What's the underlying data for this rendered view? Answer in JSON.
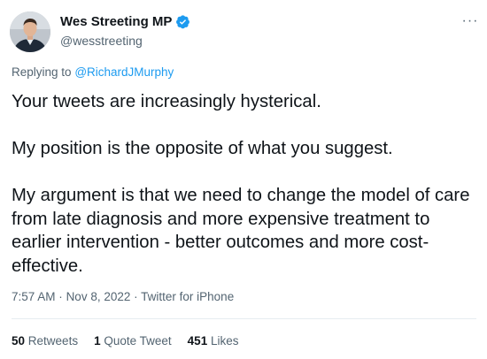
{
  "author": {
    "display_name": "Wes Streeting MP",
    "handle": "@wesstreeting",
    "verified": true,
    "verified_color": "#1d9bf0",
    "avatar_icon": "user-avatar-photo"
  },
  "reply": {
    "prefix": "Replying to",
    "mention": "@RichardJMurphy"
  },
  "tweet": {
    "paragraphs": [
      "Your tweets are increasingly hysterical.",
      "My position is the opposite of what you suggest.",
      "My argument is that we need to change the model of care from late diagnosis and more expensive treatment to earlier intervention - better outcomes and more cost-effective."
    ]
  },
  "meta": {
    "time": "7:57 AM",
    "date": "Nov 8, 2022",
    "source": "Twitter for iPhone",
    "separator": "·"
  },
  "stats": {
    "retweets_count": "50",
    "retweets_label": "Retweets",
    "quotes_count": "1",
    "quotes_label": "Quote Tweet",
    "likes_count": "451",
    "likes_label": "Likes"
  },
  "more_icon": "more-horizontal-icon",
  "colors": {
    "text": "#0f1419",
    "secondary": "#536471",
    "link": "#1d9bf0"
  }
}
